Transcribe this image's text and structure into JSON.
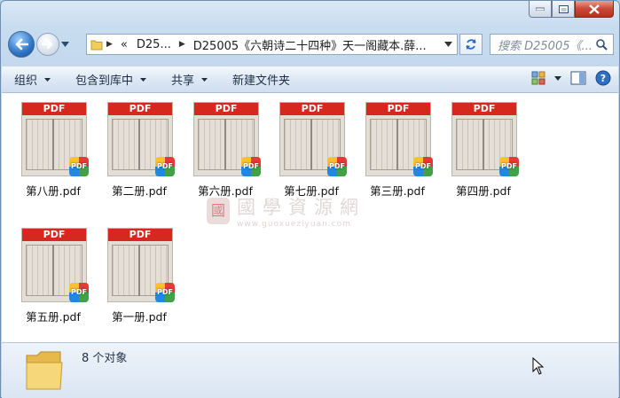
{
  "address": {
    "breadcrumb_prefix": "«",
    "parent": "D25...",
    "current": "D25005《六朝诗二十四种》天一阁藏本.薛..."
  },
  "search": {
    "placeholder": "搜索 D25005《..."
  },
  "toolbar": {
    "organize": "组织",
    "include_in_library": "包含到库中",
    "share": "共享",
    "new_folder": "新建文件夹"
  },
  "files": [
    {
      "name": "第八册.pdf",
      "thumb_label": "PDF",
      "badge": "PDF"
    },
    {
      "name": "第二册.pdf",
      "thumb_label": "PDF",
      "badge": "PDF"
    },
    {
      "name": "第六册.pdf",
      "thumb_label": "PDF",
      "badge": "PDF"
    },
    {
      "name": "第七册.pdf",
      "thumb_label": "PDF",
      "badge": "PDF"
    },
    {
      "name": "第三册.pdf",
      "thumb_label": "PDF",
      "badge": "PDF"
    },
    {
      "name": "第四册.pdf",
      "thumb_label": "PDF",
      "badge": "PDF"
    },
    {
      "name": "第五册.pdf",
      "thumb_label": "PDF",
      "badge": "PDF"
    },
    {
      "name": "第一册.pdf",
      "thumb_label": "PDF",
      "badge": "PDF"
    }
  ],
  "watermark": {
    "seal": "國",
    "text": "國學資源網",
    "url": "www.guoxueziyuan.com"
  },
  "status": {
    "item_count": "8 个对象"
  },
  "colors": {
    "pdf_red": "#d7281f",
    "window_frame": "#c2d6ec",
    "close_button": "#c9473a"
  }
}
